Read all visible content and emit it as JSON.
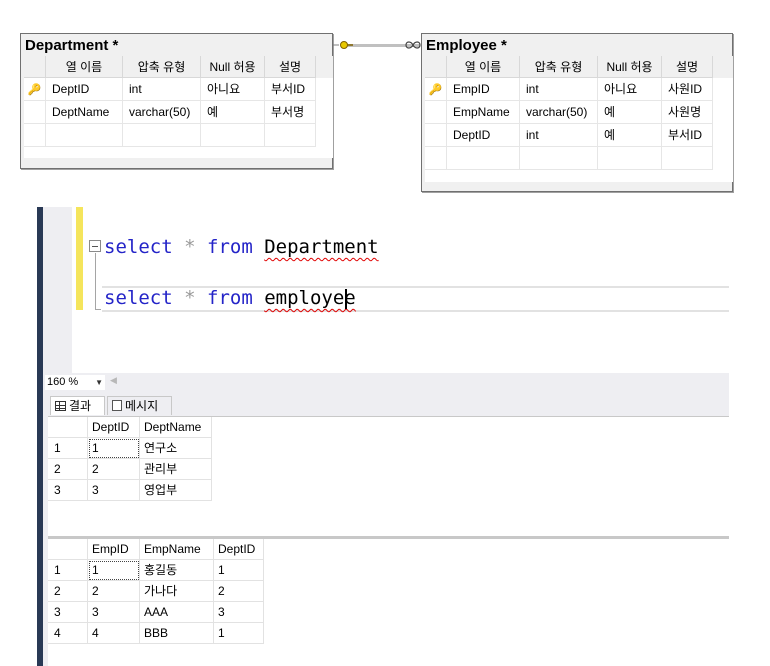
{
  "diagram": {
    "department": {
      "title": "Department *",
      "headers": [
        "열 이름",
        "압축 유형",
        "Null 허용",
        "설명"
      ],
      "rows": [
        {
          "key": true,
          "cells": [
            "DeptID",
            "int",
            "아니요",
            "부서ID"
          ]
        },
        {
          "key": false,
          "cells": [
            "DeptName",
            "varchar(50)",
            "예",
            "부서명"
          ]
        }
      ]
    },
    "employee": {
      "title": "Employee *",
      "headers": [
        "열 이름",
        "압축 유형",
        "Null 허용",
        "설명"
      ],
      "rows": [
        {
          "key": true,
          "cells": [
            "EmpID",
            "int",
            "아니요",
            "사원ID"
          ]
        },
        {
          "key": false,
          "cells": [
            "EmpName",
            "varchar(50)",
            "예",
            "사원명"
          ]
        },
        {
          "key": false,
          "cells": [
            "DeptID",
            "int",
            "예",
            "부서ID"
          ]
        }
      ]
    }
  },
  "editor": {
    "line1": {
      "kw1": "select",
      "op": "*",
      "kw2": "from",
      "ident": "Department"
    },
    "line2": {
      "kw1": "select",
      "op": "*",
      "kw2": "from",
      "ident": "employee"
    }
  },
  "zoom": {
    "value": "160 %"
  },
  "tabs": {
    "results": "결과",
    "messages": "메시지"
  },
  "result1": {
    "columns": [
      "DeptID",
      "DeptName"
    ],
    "rows": [
      [
        "1",
        "1",
        "연구소"
      ],
      [
        "2",
        "2",
        "관리부"
      ],
      [
        "3",
        "3",
        "영업부"
      ]
    ]
  },
  "result2": {
    "columns": [
      "EmpID",
      "EmpName",
      "DeptID"
    ],
    "rows": [
      [
        "1",
        "1",
        "홍길동",
        "1"
      ],
      [
        "2",
        "2",
        "가나다",
        "2"
      ],
      [
        "3",
        "3",
        "AAA",
        "3"
      ],
      [
        "4",
        "4",
        "BBB",
        "1"
      ]
    ]
  },
  "colors": {
    "accent": "#293955",
    "keyword": "#2424c8",
    "highlight": "#f5e55c"
  }
}
